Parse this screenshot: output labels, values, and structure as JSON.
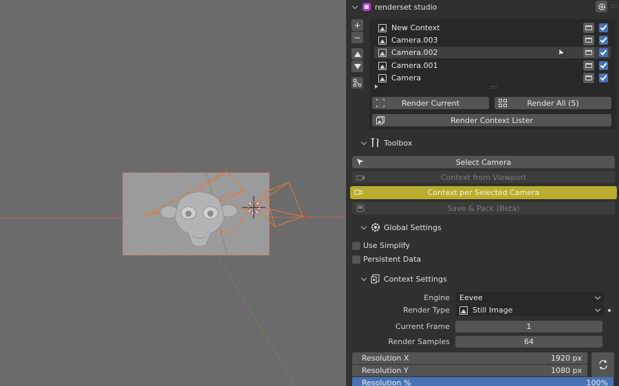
{
  "panel": {
    "addon_title": "renderset studio",
    "list": {
      "items": [
        {
          "label": "New Context",
          "selected": false
        },
        {
          "label": "Camera.003",
          "selected": false
        },
        {
          "label": "Camera.002",
          "selected": true
        },
        {
          "label": "Camera.001",
          "selected": false
        },
        {
          "label": "Camera",
          "selected": false
        }
      ],
      "grip": "::::"
    },
    "render_current_label": "Render Current",
    "render_all_label": "Render All (5)",
    "render_context_lister_label": "Render Context Lister",
    "toolbox": {
      "title": "Toolbox",
      "select_camera_label": "Select Camera",
      "context_from_viewport_label": "Context from Viewport",
      "context_per_selected_camera_label": "Context per Selected Camera",
      "save_pack_label": "Save & Pack (Beta)"
    },
    "global_settings": {
      "title": "Global Settings",
      "use_simplify_label": "Use Simplify",
      "persistent_data_label": "Persistent Data"
    },
    "context_settings": {
      "title": "Context Settings",
      "engine_label": "Engine",
      "engine_value": "Eevee",
      "render_type_label": "Render Type",
      "render_type_value": "Still Image",
      "current_frame_label": "Current Frame",
      "current_frame_value": "1",
      "render_samples_label": "Render Samples",
      "render_samples_value": "64",
      "resolution_x_label": "Resolution X",
      "resolution_x_value": "1920 px",
      "resolution_y_label": "Resolution Y",
      "resolution_y_value": "1080 px",
      "resolution_pct_label": "Resolution %",
      "resolution_pct_value": "100%"
    }
  },
  "colors": {
    "viewport_bg": "#6b6b6b",
    "panel_bg": "#303030",
    "active_button": "#b9ac2e",
    "checkbox_blue": "#4772b3",
    "camera_orange": "#e07a3c"
  },
  "icons": {
    "addon": "renderset-icon",
    "settings": "gear-icon",
    "add": "plus-icon",
    "remove": "minus-icon",
    "move_up": "arrow-up-icon",
    "move_down": "arrow-down-icon"
  }
}
